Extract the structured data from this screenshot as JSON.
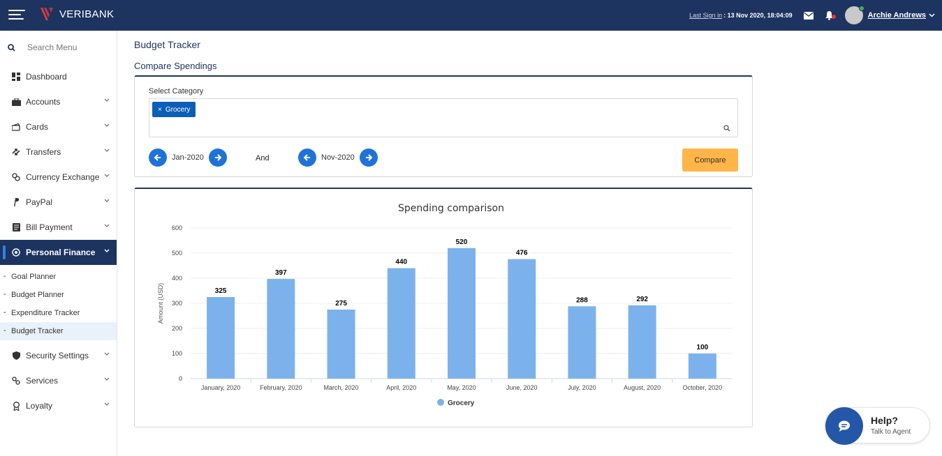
{
  "header": {
    "brand": "VERIBANK",
    "last_signin_label": "Last Sign in",
    "last_signin_value": ": 13 Nov 2020, 18:04:09",
    "username": "Archie Andrews",
    "icons": [
      "menu-icon",
      "logo-icon",
      "mail-icon",
      "bell-icon",
      "avatar",
      "chevron-down-icon"
    ]
  },
  "sidebar": {
    "search_placeholder": "Search Menu",
    "items": [
      {
        "label": "Dashboard",
        "icon": "dashboard-icon"
      },
      {
        "label": "Accounts",
        "icon": "briefcase-icon"
      },
      {
        "label": "Cards",
        "icon": "card-icon"
      },
      {
        "label": "Transfers",
        "icon": "transfer-icon"
      },
      {
        "label": "Currency Exchange",
        "icon": "currency-icon"
      },
      {
        "label": "PayPal",
        "icon": "paypal-icon"
      },
      {
        "label": "Bill Payment",
        "icon": "bill-icon"
      },
      {
        "label": "Personal Finance",
        "icon": "target-icon"
      }
    ],
    "sub_items": [
      "Goal Planner",
      "Budget Planner",
      "Expenditure Tracker",
      "Budget Tracker"
    ],
    "items_after": [
      {
        "label": "Security Settings",
        "icon": "shield-icon"
      },
      {
        "label": "Services",
        "icon": "services-icon"
      },
      {
        "label": "Loyalty",
        "icon": "award-icon"
      }
    ]
  },
  "main": {
    "page_title": "Budget Tracker",
    "section_title": "Compare Spendings",
    "select_label": "Select Category",
    "chip": "Grocery",
    "from_period": "Jan-2020",
    "and_label": "And",
    "to_period": "Nov-2020",
    "compare_button": "Compare"
  },
  "chart_data": {
    "type": "bar",
    "title": "Spending comparison",
    "xlabel": "",
    "ylabel": "Amount (USD)",
    "ylim": [
      0,
      600
    ],
    "yticks": [
      0,
      100,
      200,
      300,
      400,
      500,
      600
    ],
    "grid": true,
    "legend_position": "bottom",
    "categories": [
      "January, 2020",
      "February, 2020",
      "March, 2020",
      "April, 2020",
      "May, 2020",
      "June, 2020",
      "July, 2020",
      "August, 2020",
      "October, 2020"
    ],
    "series": [
      {
        "name": "Grocery",
        "color": "#7cb2eb",
        "values": [
          325,
          397,
          275,
          440,
          520,
          476,
          288,
          292,
          100
        ]
      }
    ]
  },
  "help": {
    "title": "Help?",
    "subtitle": "Talk to Agent"
  },
  "colors": {
    "navy": "#1d3461",
    "accent_blue": "#1f73d8",
    "chip_blue": "#0b5fb8",
    "compare_orange": "#ffb547",
    "bar_blue": "#7cb2eb"
  }
}
